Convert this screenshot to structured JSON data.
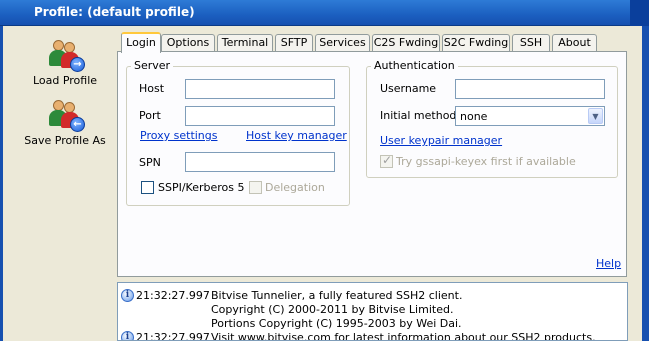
{
  "window": {
    "title": "Profile:  (default profile)"
  },
  "sidebar": {
    "load_profile": "Load Profile",
    "save_profile_as": "Save Profile As"
  },
  "tabs": [
    "Login",
    "Options",
    "Terminal",
    "SFTP",
    "Services",
    "C2S Fwding",
    "S2C Fwding",
    "SSH",
    "About"
  ],
  "active_tab": "Login",
  "server": {
    "legend": "Server",
    "host_label": "Host",
    "host_value": "",
    "port_label": "Port",
    "port_value": "",
    "proxy_link": "Proxy settings",
    "hostkey_link": "Host key manager",
    "spn_label": "SPN",
    "spn_value": "",
    "sspi_label": "SSPI/Kerberos 5",
    "delegation_label": "Delegation"
  },
  "auth": {
    "legend": "Authentication",
    "username_label": "Username",
    "username_value": "",
    "method_label": "Initial method",
    "method_value": "none",
    "keypair_link": "User keypair manager",
    "gssapi_label": "Try gssapi-keyex first if available"
  },
  "help_link": "Help",
  "log": [
    {
      "time": "21:32:27.997",
      "lines": [
        "Bitvise Tunnelier, a fully featured SSH2 client.",
        "Copyright (C) 2000-2011 by Bitvise Limited.",
        "Portions Copyright (C) 1995-2003 by Wei Dai."
      ]
    },
    {
      "time": "21:32:27.997",
      "lines": [
        "Visit www.bitvise.com for latest information about our SSH2 products."
      ]
    }
  ],
  "colors": {
    "titlebar": "#1b5fc0",
    "link": "#0033cc",
    "active_tab_accent": "#ffc83c"
  }
}
